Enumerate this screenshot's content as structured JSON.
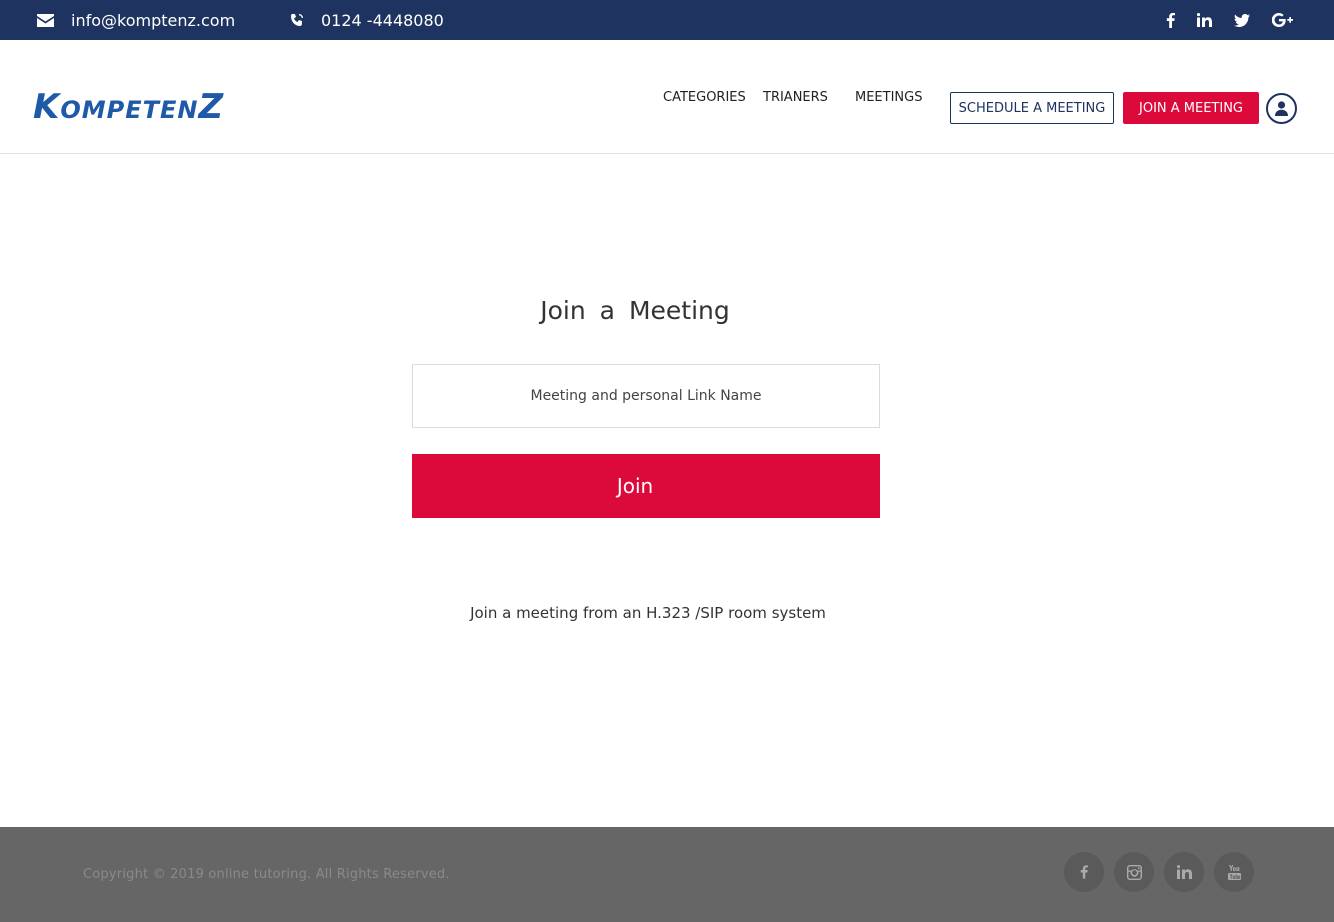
{
  "topbar": {
    "email": "info@komptenz.com",
    "phone": "0124 -4448080",
    "social_icons": [
      "facebook-icon",
      "linkedin-icon",
      "twitter-icon",
      "google-plus-icon"
    ]
  },
  "header": {
    "logo_text": "KompetenZ",
    "nav": [
      "CATEGORIES",
      "TRIANERS",
      "MEETINGS"
    ],
    "schedule_button": "SCHEDULE A MEETING",
    "join_button": "JOIN A MEETING",
    "user_icon": "user-circle-icon"
  },
  "main": {
    "title": "Join  a  Meeting",
    "input_placeholder": "Meeting and personal Link Name",
    "input_value": "",
    "join_label": "Join",
    "room_link": "Join  a meeting from an H.323 /SIP room system"
  },
  "footer": {
    "copyright": "Copyright © 2019 online tutoring. All Rights Reserved.",
    "social_icons": [
      "facebook-icon",
      "instagram-icon",
      "linkedin-icon",
      "youtube-icon"
    ]
  },
  "colors": {
    "topbar": "#1e3360",
    "accent": "#dc0a3b",
    "logo": "#1f5aa8",
    "footer": "#666666"
  }
}
